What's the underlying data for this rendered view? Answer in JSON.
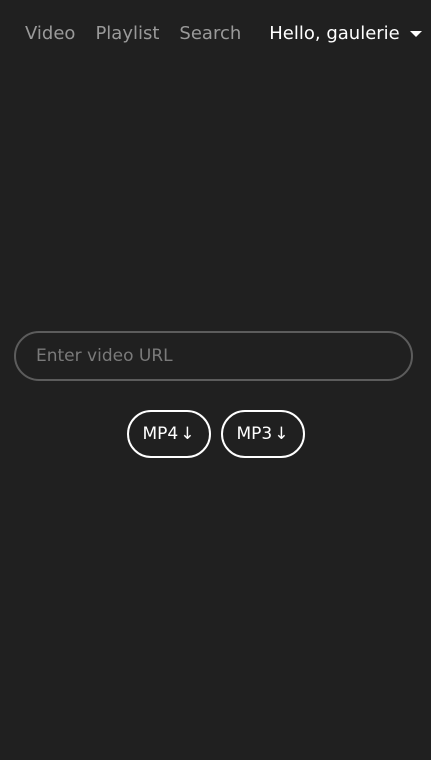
{
  "nav": {
    "links": [
      {
        "label": "Video"
      },
      {
        "label": "Playlist"
      },
      {
        "label": "Search"
      }
    ],
    "user_greeting": "Hello, gaulerie",
    "user_menu_icon": "caret-down-icon"
  },
  "main": {
    "url_input": {
      "placeholder": "Enter video URL",
      "value": ""
    },
    "buttons": [
      {
        "label": "MP4",
        "icon": "download-arrow-icon",
        "icon_glyph": "↓"
      },
      {
        "label": "MP3",
        "icon": "download-arrow-icon",
        "icon_glyph": "↓"
      }
    ]
  },
  "colors": {
    "background": "#202020",
    "nav_inactive": "#9a9a9a",
    "text": "#ffffff",
    "input_border": "#5c5c5c",
    "placeholder": "#7a7a7a"
  }
}
